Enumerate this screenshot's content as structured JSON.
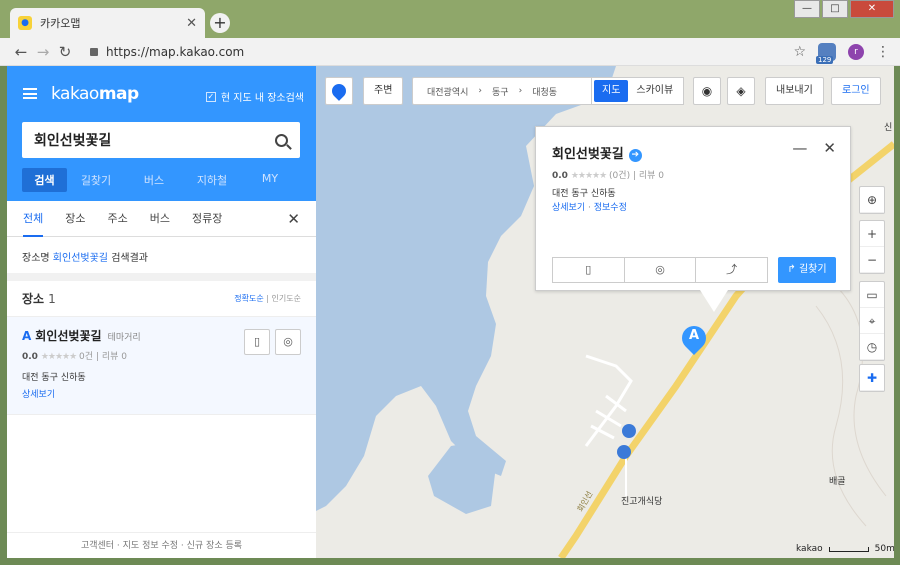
{
  "browser": {
    "tab_title": "카카오맵",
    "tab_close": "✕",
    "new_tab": "+",
    "url": "https://map.kakao.com",
    "back": "←",
    "forward": "→",
    "reload": "↻",
    "star": "☆",
    "ext_badge": "129",
    "profile_initial": "r",
    "menu": "⋮",
    "win_min": "—",
    "win_max": "□",
    "win_close": "✕"
  },
  "sidebar": {
    "logo_light": "kakao",
    "logo_bold": "map",
    "checkbox_label": "현 지도 내 장소검색",
    "checkbox_mark": "✓",
    "search_value": "회인선벚꽃길",
    "main_tabs": [
      "검색",
      "길찾기",
      "버스",
      "지하철",
      "MY"
    ],
    "sub_tabs": [
      "전체",
      "장소",
      "주소",
      "버스",
      "정류장"
    ],
    "close": "✕",
    "result_prefix": "장소명",
    "result_keyword": "회인선벚꽃길",
    "result_suffix": "검색결과",
    "section_title": "장소",
    "section_count": "1",
    "sort_accuracy": "정확도순",
    "sort_popular": "인기도순",
    "sort_sep": "|",
    "item": {
      "letter": "A",
      "name": "회인선벚꽃길",
      "category": "테마거리",
      "score": "0.0",
      "stars": "★★★★★",
      "reviews_count": "0건",
      "reviews_sep": "|",
      "reviews_label": "리뷰 0",
      "address": "대전 동구 신하동",
      "detail": "상세보기"
    },
    "footer": "고객센터 · 지도 정보 수정 · 신규 장소 등록",
    "collapse": "◀"
  },
  "map": {
    "nearby": "주변",
    "crumbs": [
      "대전광역시",
      "동구",
      "대청동"
    ],
    "crumb_sep": "›",
    "map_mode": "지도",
    "sky_mode": "스카이뷰",
    "export": "내보내기",
    "login": "로그인",
    "popup": {
      "title": "회인선벚꽃길",
      "go": "➔",
      "min": "—",
      "close": "✕",
      "score": "0.0",
      "stars": "★★★★★",
      "count": "(0건)",
      "reviews": "리뷰 0",
      "address": "대전 동구 신하동",
      "detail": "상세보기",
      "dot": "·",
      "edit": "정보수정",
      "route": "길찾기",
      "route_icon": "↱"
    },
    "marker_letter": "A",
    "labels": {
      "restaurant": "진고개식당",
      "place": "배골",
      "road": "회인선",
      "corner": "신"
    },
    "scale_logo": "kakao",
    "scale_value": "50m",
    "tools": [
      "⊕",
      "+",
      "−",
      "▭",
      "⌖",
      "◷"
    ]
  }
}
